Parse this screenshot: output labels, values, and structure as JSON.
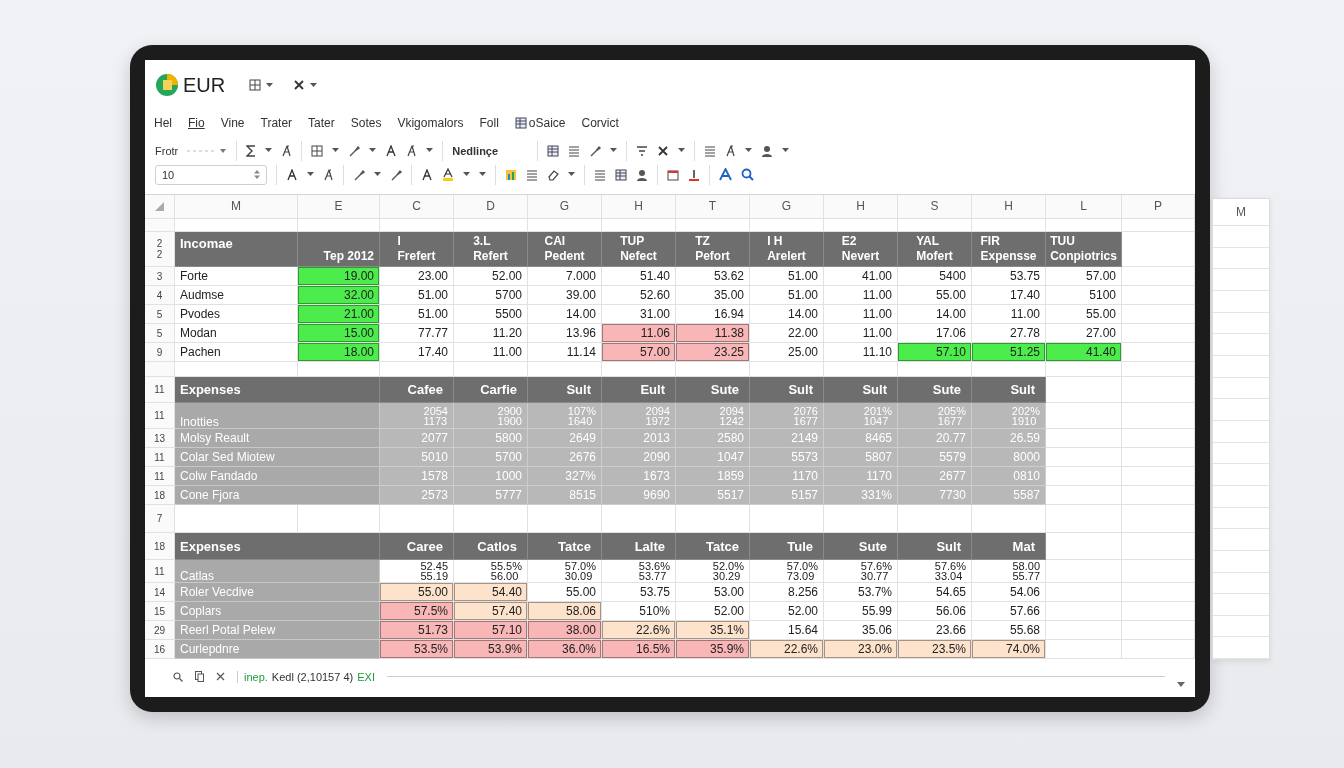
{
  "app": {
    "title": "EUR"
  },
  "menu": [
    {
      "label": "Hel",
      "selected": false
    },
    {
      "label": "Fio",
      "selected": true
    },
    {
      "label": "Vine",
      "selected": false
    },
    {
      "label": "Trater",
      "selected": false
    },
    {
      "label": "Tater",
      "selected": false
    },
    {
      "label": "Sotes",
      "selected": false
    },
    {
      "label": "Vkigomalors",
      "selected": false
    },
    {
      "label": "Foll",
      "selected": false
    },
    {
      "label": "oSaice",
      "selected": false,
      "icon": true
    },
    {
      "label": "Corvict",
      "selected": false
    }
  ],
  "ribbon": {
    "font_label": "Frotr",
    "font_size": "10",
    "style_label": "Nedlinçe"
  },
  "sheet": {
    "columns": [
      "M",
      "E",
      "C",
      "D",
      "G",
      "H",
      "T",
      "G",
      "H",
      "S",
      "H",
      "L",
      "P"
    ],
    "income": {
      "row_numbers": [
        "2",
        "2"
      ],
      "label": "Incomae",
      "headers": [
        [
          "Tep 2012"
        ],
        [
          "I",
          "Frefert"
        ],
        [
          "3.L",
          "Refert"
        ],
        [
          "CAI",
          "Pedent"
        ],
        [
          "TUP",
          "Nefect"
        ],
        [
          "TZ",
          "Pefort"
        ],
        [
          "I H",
          "Arelert"
        ],
        [
          "E2",
          "Nevert"
        ],
        [
          "YAL",
          "Mofert"
        ],
        [
          "FIR",
          "Expensse"
        ],
        [
          "TUU",
          "Conpiotrics"
        ]
      ],
      "rows": [
        {
          "number": "3",
          "label": "Forte",
          "cells": [
            {
              "text": "19.00",
              "color": "#4cec4c"
            },
            "23.00",
            "52.00",
            "7.000",
            "51.40",
            "53.62",
            "51.00",
            "41.00",
            "5400",
            "53.75",
            "57.00"
          ]
        },
        {
          "number": "4",
          "label": "Audmse",
          "cells": [
            {
              "text": "32.00",
              "color": "#4cec4c"
            },
            "51.00",
            "5700",
            "39.00",
            "52.60",
            "35.00",
            "51.00",
            "11.00",
            "55.00",
            "17.40",
            "5100"
          ]
        },
        {
          "number": "5",
          "label": "Pvodes",
          "cells": [
            {
              "text": "21.00",
              "color": "#4cec4c"
            },
            "51.00",
            "5500",
            "14.00",
            "31.00",
            "16.94",
            "14.00",
            "11.00",
            "14.00",
            "11.00",
            "55.00"
          ]
        },
        {
          "number": "5",
          "label": "Modan",
          "cells": [
            {
              "text": "15.00",
              "color": "#4cec4c"
            },
            "77.77",
            "11.20",
            "13.96",
            {
              "text": "11.06",
              "color": "#f8b6b6"
            },
            {
              "text": "11.38",
              "color": "#f8b6b6"
            },
            "22.00",
            "11.00",
            "17.06",
            "27.78",
            "27.00"
          ]
        },
        {
          "number": "9",
          "label": "Pachen",
          "cells": [
            {
              "text": "18.00",
              "color": "#4cec4c"
            },
            "17.40",
            "11.00",
            "11.14",
            {
              "text": "57.00",
              "color": "#f8b6b6"
            },
            {
              "text": "23.25",
              "color": "#f8b6b6"
            },
            "25.00",
            "11.10",
            {
              "text": "57.10",
              "color": "#4cec4c"
            },
            {
              "text": "51.25",
              "color": "#4cec4c"
            },
            {
              "text": "41.40",
              "color": "#4cec4c"
            }
          ]
        }
      ]
    },
    "blank_row_number": "7",
    "expenses": [
      {
        "number": "11",
        "label": "Expenses",
        "shaded": true,
        "headers": [
          "Cafee",
          "Carfie",
          "Sult",
          "Eult",
          "Sute",
          "Sult",
          "Sult",
          "Sute",
          "Sult"
        ],
        "rows": [
          {
            "number": "11",
            "label": "Inotties",
            "cells": [
              {
                "lines": [
                  "2054",
                  "1173"
                ]
              },
              {
                "lines": [
                  "2900",
                  "1900"
                ]
              },
              {
                "lines": [
                  "107%",
                  "1640"
                ]
              },
              {
                "lines": [
                  "2094",
                  "1972"
                ]
              },
              {
                "lines": [
                  "2094",
                  "1242"
                ]
              },
              {
                "lines": [
                  "2076",
                  "1677"
                ]
              },
              {
                "lines": [
                  "201%",
                  "1047"
                ]
              },
              {
                "lines": [
                  "205%",
                  "1677"
                ]
              },
              {
                "lines": [
                  "202%",
                  "1910"
                ]
              }
            ]
          },
          {
            "number": "13",
            "label": "Molsy Reault",
            "cells": [
              "2077",
              "5800",
              "2649",
              "2013",
              "2580",
              "2149",
              "8465",
              "20.77",
              "26.59"
            ]
          },
          {
            "number": "11",
            "label": "Colar Sed Miotew",
            "cells": [
              "5010",
              "5700",
              "2676",
              "2090",
              "1047",
              "5573",
              "5807",
              "5579",
              "8000"
            ]
          },
          {
            "number": "11",
            "label": "Colw Fandado",
            "cells": [
              "1578",
              "1000",
              "327%",
              "1673",
              "1859",
              "1170",
              "1170",
              "2677",
              "0810"
            ]
          },
          {
            "number": "18",
            "label": "Cone Fjora",
            "cells": [
              "2573",
              "5777",
              "8515",
              "9690",
              "5517",
              "5157",
              "331%",
              "7730",
              "5587"
            ]
          }
        ]
      },
      {
        "number": "18",
        "label": "Expenses",
        "shaded": false,
        "headers": [
          "Caree",
          "Catlos",
          "Tatce",
          "Lalte",
          "Tatce",
          "Tule",
          "Sute",
          "Sult",
          "Mat"
        ],
        "rows": [
          {
            "number": "11",
            "label": "Catlas",
            "cells": [
              {
                "lines": [
                  "52.45",
                  "55.19"
                ]
              },
              {
                "lines": [
                  "55.5%",
                  "56.00"
                ]
              },
              {
                "lines": [
                  "57.0%",
                  "30.09"
                ]
              },
              {
                "lines": [
                  "53.6%",
                  "53.77"
                ]
              },
              {
                "lines": [
                  "52.0%",
                  "30.29"
                ]
              },
              {
                "lines": [
                  "57.0%",
                  "73.09"
                ]
              },
              {
                "lines": [
                  "57.6%",
                  "30.77"
                ]
              },
              {
                "lines": [
                  "57.6%",
                  "33.04"
                ]
              },
              {
                "lines": [
                  "58.00",
                  "55.77"
                ]
              }
            ]
          },
          {
            "number": "14",
            "label": "Roler Vecdive",
            "cells": [
              {
                "text": "55.00",
                "color": "#fde3cc"
              },
              {
                "text": "54.40",
                "color": "#fde3cc"
              },
              "55.00",
              "53.75",
              "53.00",
              "8.256",
              "53.7%",
              "54.65",
              "54.06"
            ]
          },
          {
            "number": "15",
            "label": "Coplars",
            "cells": [
              {
                "text": "57.5%",
                "color": "#f8b6b6"
              },
              {
                "text": "57.40",
                "color": "#fde3cc"
              },
              {
                "text": "58.06",
                "color": "#fde3cc"
              },
              "510%",
              "52.00",
              "52.00",
              "55.99",
              "56.06",
              "57.66"
            ]
          },
          {
            "number": "29",
            "label": "Reerl Potal Pelew",
            "cells": [
              {
                "text": "51.73",
                "color": "#f8b6b6"
              },
              {
                "text": "57.10",
                "color": "#f8b6b6"
              },
              {
                "text": "38.00",
                "color": "#f8b6b6"
              },
              {
                "text": "22.6%",
                "color": "#fde3cc"
              },
              {
                "text": "35.1%",
                "color": "#fde3cc"
              },
              "15.64",
              "35.06",
              "23.66",
              "55.68"
            ]
          },
          {
            "number": "16",
            "label": "Curlepdnre",
            "cells": [
              {
                "text": "53.5%",
                "color": "#f8b6b6"
              },
              {
                "text": "53.9%",
                "color": "#f8b6b6"
              },
              {
                "text": "36.0%",
                "color": "#f8b6b6"
              },
              {
                "text": "16.5%",
                "color": "#f8b6b6"
              },
              {
                "text": "35.9%",
                "color": "#f8b6b6"
              },
              {
                "text": "22.6%",
                "color": "#fde3cc"
              },
              {
                "text": "23.0%",
                "color": "#fde3cc"
              },
              {
                "text": "23.5%",
                "color": "#fde3cc"
              },
              {
                "text": "74.0%",
                "color": "#fde3cc"
              }
            ]
          }
        ]
      }
    ]
  },
  "status_bar": {
    "prefix": "inep.",
    "text": "Kedl (2,10157 4)",
    "suffix": "EXI"
  },
  "side_sheet": {
    "column": "M"
  }
}
